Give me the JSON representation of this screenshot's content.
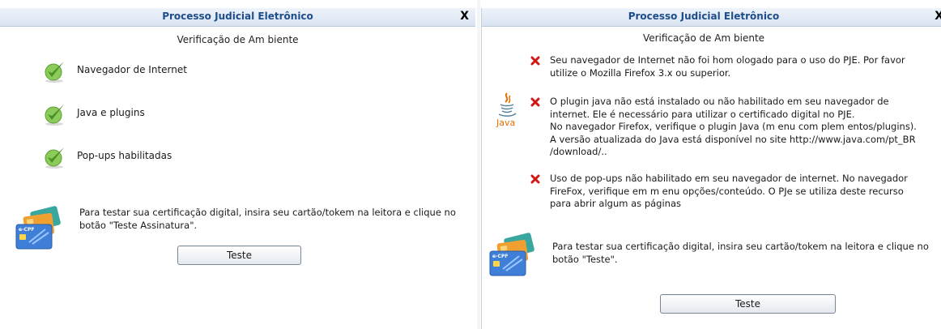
{
  "left_panel": {
    "title": "Processo Judicial Eletrônico",
    "close": "X",
    "subtitle": "Verificação de Am biente",
    "checks": [
      {
        "label": "Navegador de Internet",
        "icon": "green-check-icon"
      },
      {
        "label": "Java e plugins",
        "icon": "green-check-icon"
      },
      {
        "label": "Pop-ups habilitadas",
        "icon": "green-check-icon"
      }
    ],
    "cert_text_line1": "Para testar sua certificação digital, insira seu cartão/tokem  na leitora e clique no",
    "cert_text_line2": "botão \"Teste Assinatura\".",
    "button_label": "Teste"
  },
  "right_panel": {
    "title": "Processo Judicial Eletrônico",
    "close": "X",
    "subtitle": "Verificação de Am biente",
    "java_logo_text": "Java",
    "errors": [
      {
        "lines": [
          "Seu navegador de Internet não foi hom ologado para o uso do PJE. Por favor",
          "utilize o Mozilla Firefox 3.x ou superior."
        ]
      },
      {
        "lines": [
          "O plugin java não está instalado ou não habilitado em  seu navegador de",
          "internet. Ele é necessário para utilizar o certificado digital no PJE.",
          "No navegador Firefox, verifique o plugin Java (m enu com plem entos/plugins).",
          "A versão atualizada do Java está disponível no site http://www.java.com/pt_BR",
          "/download/.."
        ]
      },
      {
        "lines": [
          "Uso de pop-ups não habilitado em  seu navegador de internet. No navegador",
          "FireFox, verifique em  m enu opções/conteúdo. O PJe se utiliza deste recurso",
          "para abrir algum as páginas"
        ]
      }
    ],
    "cert_text_line1": "Para testar sua certificação digital, insira seu cartão/tokem  na leitora e clique no",
    "cert_text_line2": "botão \"Teste\".",
    "button_label": "Teste"
  },
  "card_brand_text": "e-CPF",
  "colors": {
    "title": "#1e4d8c",
    "check_green": "#6cbb3c",
    "error_red": "#d01818",
    "java_orange": "#e76f00",
    "java_blue": "#5382a1"
  }
}
